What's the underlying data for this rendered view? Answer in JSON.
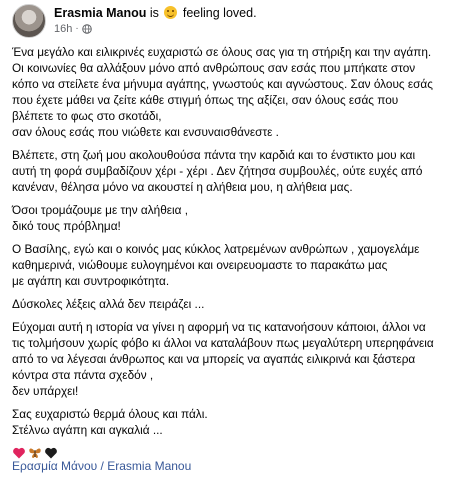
{
  "header": {
    "author": "Erasmia Manou",
    "is_word": "is",
    "feeling": "feeling loved.",
    "time": "16h",
    "separator": "·"
  },
  "body": {
    "paragraphs": [
      [
        "Ένα μεγάλο και ειλικρινές ευχαριστώ σε όλους σας για τη στήριξη και την αγάπη.",
        "Οι κοινωνίες θα αλλάξουν μόνο από ανθρώπους σαν εσάς που μπήκατε στον",
        "κόπο να στείλετε ένα μήνυμα αγάπης, γνωστούς και αγνώστους. Σαν όλους εσάς",
        "που έχετε μάθει να ζείτε κάθε στιγμή όπως της αξίζει, σαν όλους εσάς που",
        "βλέπετε το φως στο σκοτάδι,",
        "σαν όλους εσάς που νιώθετε και ενσυναισθάνεστε ."
      ],
      [
        "Βλέπετε, στη ζωή μου ακολουθούσα πάντα την καρδιά και το ένστικτο μου και",
        "αυτή τη φορά συμβαδίζουν χέρι - χέρι . Δεν ζήτησα συμβουλές, ούτε ευχές από",
        "κανέναν, θέλησα μόνο να ακουστεί η αλήθεια μου, η αλήθεια μας."
      ],
      [
        "Όσοι τρομάζουμε με την αλήθεια ,",
        "δικό τους πρόβλημα!"
      ],
      [
        "Ο Βασίλης, εγώ και ο κοινός μας κύκλος λατρεμένων ανθρώπων , χαμογελάμε",
        "καθημερινά, νιώθουμε ευλογημένοι και ονειρευομαστε το παρακάτω μας",
        "με αγάπη και συντροφικότητα."
      ],
      [
        "Δύσκολες λέξεις αλλά δεν πειράζει ..."
      ],
      [
        "Εύχομαι αυτή η ιστορία να γίνει η αφορμή να τις κατανοήσουν κάποιοι, άλλοι να",
        "τις τολμήσουν χωρίς φόβο κι άλλοι να καταλάβουν πως μεγαλύτερη υπερηφάνεια",
        "από το να λέγεσαι άνθρωπος και να μπορείς να αγαπάς ειλικρινά και ξάστερα",
        "κόντρα στα πάντα σχεδόν ,",
        "δεν υπάρχει!"
      ],
      [
        "Σας ευχαριστώ θερμά όλους και πάλι.",
        "Στέλνω αγάπη και αγκαλιά ..."
      ]
    ],
    "emoji_icons": [
      "red-heart-icon",
      "butterfly-icon",
      "black-heart-icon"
    ]
  },
  "tags": {
    "tag1": "Ερασμία Μάνου",
    "separator": "/",
    "tag2": "Erasmia Manou"
  },
  "colors": {
    "link": "#385898",
    "meta": "#65676b",
    "text": "#050505",
    "heart_red": "#e0245e",
    "butterfly": "#c8792a",
    "heart_black": "#1c1c1c"
  }
}
